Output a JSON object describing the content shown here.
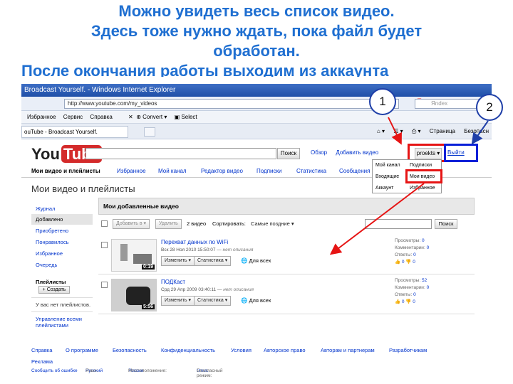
{
  "caption": {
    "line1": "Можно увидеть весь список видео.",
    "line2": "Здесь тоже нужно ждать, пока файл будет",
    "line3": "обработан.",
    "line4": "После окончания работы выходим из аккаунта"
  },
  "browser": {
    "title": "Broadcast Yourself. - Windows Internet Explorer",
    "url": "http://www.youtube.com/my_videos",
    "search_engine": "Я",
    "search_placeholder": "Яndex",
    "menu": [
      "Избранное",
      "Сервис",
      "Справка"
    ],
    "convert_label": "Convert",
    "select_label": "Select",
    "tab_label": "ouTube - Broadcast Yourself.",
    "tab_tools": [
      "Страница",
      "Безопасн"
    ]
  },
  "youtube": {
    "logo_you": "You",
    "logo_tube": "Tube",
    "search_button": "Поиск",
    "top_links": [
      "Обзор",
      "Добавить видео"
    ],
    "user_name": "proekts",
    "logout": "Выйти",
    "nav": [
      "Мои видео и плейлисты",
      "Избранное",
      "Мой канал",
      "Редактор видео",
      "Подписки",
      "Статистика",
      "Сообщения"
    ],
    "user_menu": {
      "left": [
        "Мой канал",
        "Входящие",
        "Аккаунт"
      ],
      "right": [
        "Подписки",
        "Мои видео",
        "Избранное"
      ]
    },
    "page_title": "Мои видео и плейлисты",
    "sidebar": {
      "items": [
        "Журнал",
        "Добавлено",
        "Приобретено",
        "Понравилось",
        "Избранное",
        "Очередь"
      ],
      "playlists_header": "Плейлисты",
      "create_button": "+ Создать",
      "no_playlists": "У вас нет плейлистов.",
      "manage_link": "Управление всеми плейлистами"
    },
    "main": {
      "header": "Мои добавленные видео",
      "add_to_button": "Добавить в",
      "delete_button": "Удалить",
      "video_count": "2 видео",
      "sort_label": "Сортировать:",
      "sort_value": "Самые поздние",
      "search_button": "Поиск",
      "edit_button": "Изменить",
      "stats_button": "Статистика",
      "access": "Для всех",
      "no_description": "нет описания",
      "stat_labels": [
        "Просмотры:",
        "Комментарии:",
        "Ответы:"
      ],
      "videos": [
        {
          "title": "Перехват данных по WiFi",
          "date": "Вск 28 Ноя 2010 15:50:07",
          "duration": "0:19",
          "views": "0",
          "comments": "0",
          "replies": "0",
          "likes": "0",
          "dislikes": "0"
        },
        {
          "title": "ПОДКаст",
          "date": "Срд 29 Апр 2009 03:40:11",
          "duration": "5:56",
          "views": "52",
          "comments": "0",
          "replies": "0",
          "likes": "0",
          "dislikes": "0"
        }
      ]
    },
    "footer": {
      "links": [
        "Справка",
        "О программе",
        "Безопасность",
        "Конфиденциальность",
        "Условия",
        "Авторское право",
        "Авторам и партнерам",
        "Разработчикам",
        "Реклама"
      ],
      "report_bug": "Сообщить об ошибке",
      "language_label": "Язык:",
      "language_value": "Русский",
      "location_label": "Местоположение:",
      "location_value": "Россия",
      "safety_label": "Безопасный режим:",
      "safety_value": "Откл."
    }
  },
  "callouts": [
    "1",
    "2"
  ],
  "colors": {
    "caption": "#1f6fd1",
    "highlight_red": "#e61414",
    "highlight_blue": "#0a20d8",
    "link": "#0033cc"
  }
}
